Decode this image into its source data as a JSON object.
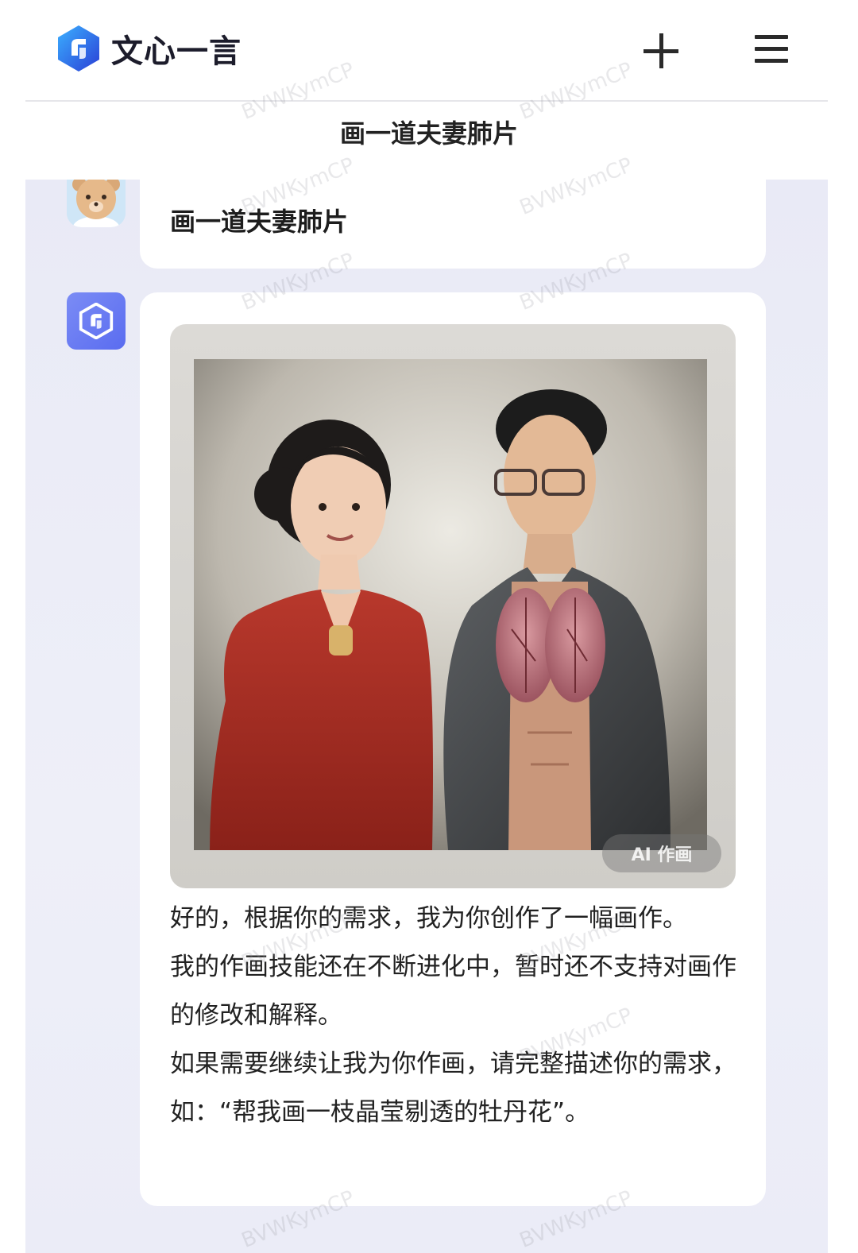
{
  "header": {
    "app_name": "文心一言",
    "new_chat_icon": "plus-icon",
    "menu_icon": "hamburger-menu-icon"
  },
  "conversation": {
    "title": "画一道夫妻肺片"
  },
  "messages": {
    "user": {
      "text": "画一道夫妻肺片",
      "avatar": "bear-avatar"
    },
    "assistant": {
      "avatar": "ernie-logo-avatar",
      "image_badge": "AI 作画",
      "paragraphs": [
        "好的，根据你的需求，我为你创作了一幅画作。",
        "我的作画技能还在不断进化中，暂时还不支持对画作的修改和解释。",
        "如果需要继续让我为你作画，请完整描述你的需求，如：“帮我画一枝晶莹剔透的牡丹花”。"
      ]
    }
  },
  "watermark_text": "BVWKymCP",
  "colors": {
    "brand_blue": "#3d5afe",
    "chat_background": "#eceef8",
    "bubble": "#ffffff"
  }
}
